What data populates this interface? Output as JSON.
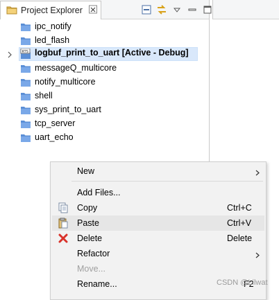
{
  "view": {
    "tab_title": "Project Explorer",
    "toolbar": [
      "collapse-all-icon",
      "link-with-editor-icon",
      "view-menu-icon",
      "minimize-icon",
      "maximize-icon"
    ]
  },
  "tree": {
    "items": [
      {
        "label": "ipc_notify",
        "icon": "folder-icon"
      },
      {
        "label": "led_flash",
        "icon": "folder-icon"
      },
      {
        "label": "logbuf_print_to_uart  [Active - Debug]",
        "icon": "rts-project-icon",
        "selected": true,
        "expandable": true
      },
      {
        "label": "messageQ_multicore",
        "icon": "folder-icon"
      },
      {
        "label": "notify_multicore",
        "icon": "folder-icon"
      },
      {
        "label": "shell",
        "icon": "folder-icon"
      },
      {
        "label": "sys_print_to_uart",
        "icon": "folder-icon"
      },
      {
        "label": "tcp_server",
        "icon": "folder-icon"
      },
      {
        "label": "uart_echo",
        "icon": "folder-icon"
      }
    ]
  },
  "context_menu": {
    "items": [
      {
        "label": "New",
        "submenu": true
      },
      {
        "label": "Add Files..."
      },
      {
        "label": "Copy",
        "shortcut": "Ctrl+C",
        "icon": "copy-icon"
      },
      {
        "label": "Paste",
        "shortcut": "Ctrl+V",
        "icon": "paste-icon",
        "hover": true
      },
      {
        "label": "Delete",
        "shortcut": "Delete",
        "icon": "delete-icon"
      },
      {
        "label": "Refactor",
        "submenu": true
      },
      {
        "label": "Move...",
        "disabled": true
      },
      {
        "label": "Rename...",
        "shortcut": "F2"
      }
    ]
  },
  "watermark": "CSDN @Lilwat",
  "colors": {
    "selection": "#d9e8fb",
    "folder": "#5b8fd6",
    "delete": "#d9322a",
    "menu_bg": "#f2f2f2"
  }
}
